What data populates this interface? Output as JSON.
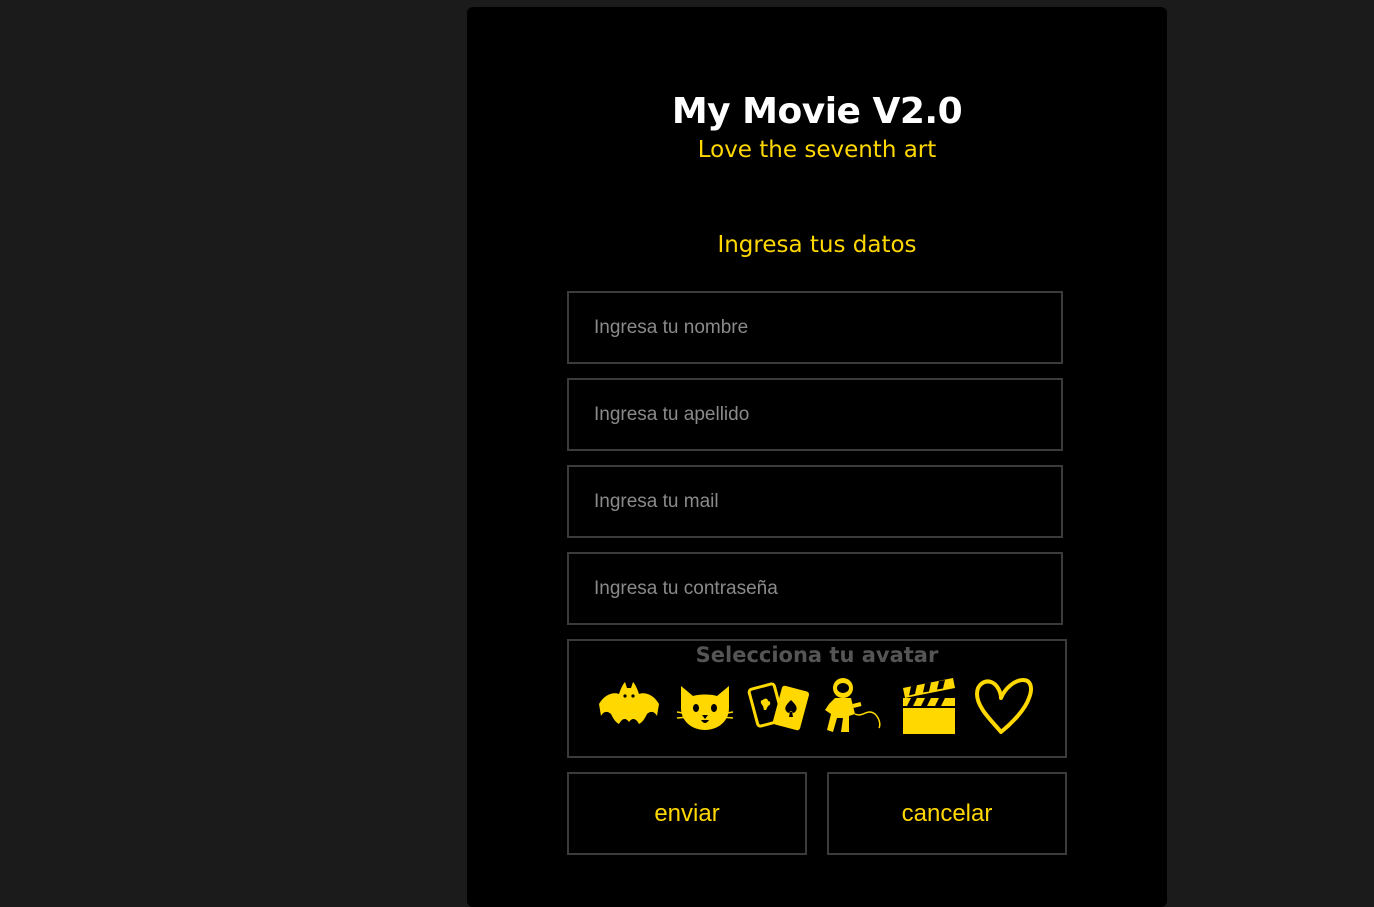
{
  "header": {
    "title": "My Movie V2.0",
    "subtitle": "Love the seventh art"
  },
  "form": {
    "section_title": "Ingresa tus datos",
    "fields": {
      "nombre": {
        "placeholder": "Ingresa tu nombre",
        "value": ""
      },
      "apellido": {
        "placeholder": "Ingresa tu apellido",
        "value": ""
      },
      "mail": {
        "placeholder": "Ingresa tu mail",
        "value": ""
      },
      "password": {
        "placeholder": "Ingresa tu contraseña",
        "value": ""
      }
    },
    "avatar": {
      "label": "Selecciona tu avatar",
      "options": [
        "bat-icon",
        "cat-icon",
        "playing-cards-icon",
        "astronaut-icon",
        "clapperboard-icon",
        "heart-icon"
      ]
    },
    "buttons": {
      "submit": "enviar",
      "cancel": "cancelar"
    }
  },
  "colors": {
    "accent": "#ffd800",
    "card_background": "#000000",
    "page_background": "#1b1b1b",
    "border": "#3b3b3b"
  }
}
